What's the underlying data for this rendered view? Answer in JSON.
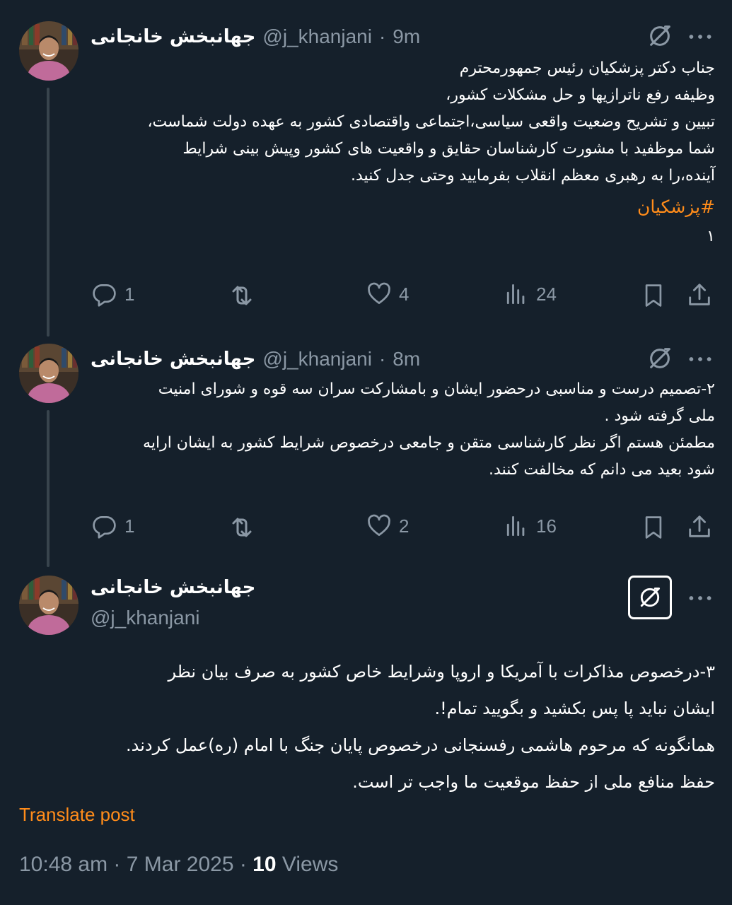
{
  "colors": {
    "background": "#15202b",
    "text": "#ffffff",
    "secondary": "#8b98a5",
    "accent": "#ff8c1a"
  },
  "tweets": [
    {
      "author_name": "جهانبخش خانجانی",
      "handle": "@j_khanjani",
      "time": "9m",
      "lines": [
        "جناب دکتر پزشکیان رئیس جمهورمحترم",
        "وظیفه رفع ناترازیها و حل مشکلات کشور،",
        "تبیین و تشریح وضعیت واقعی سیاسی،اجتماعی واقتصادی کشور به عهده دولت شماست،",
        "شما موظفید با مشورت کارشناسان حقایق و واقعیت های کشور وپیش بینی شرایط",
        "آینده،را به رهبری معظم انقلاب بفرمایید وحتی جدل کنید."
      ],
      "hashtag": "#پزشکیان",
      "number": "۱",
      "replies": "1",
      "likes": "4",
      "views": "24"
    },
    {
      "author_name": "جهانبخش خانجانی",
      "handle": "@j_khanjani",
      "time": "8m",
      "lines": [
        "۲-تصمیم درست و مناسبی درحضور ایشان و بامشارکت سران سه قوه و شورای امنیت",
        "ملی گرفته شود .",
        "مطمئن هستم اگر نظر کارشناسی متقن و جامعی درخصوص شرایط کشور به ایشان ارایه",
        "شود بعید می دانم که مخالفت کنند."
      ],
      "replies": "1",
      "likes": "2",
      "views": "16"
    }
  ],
  "main_tweet": {
    "author_name": "جهانبخش خانجانی",
    "handle": "@j_khanjani",
    "lines": [
      "۳-درخصوص مذاکرات با آمریکا و اروپا وشرایط خاص کشور به صرف بیان نظر",
      "ایشان نباید پا پس بکشید و بگویید تمام!.",
      "همانگونه که مرحوم هاشمی رفسنجانی درخصوص پایان جنگ با امام (ره)عمل کردند.",
      "حفظ منافع ملی از حفظ موقعیت ما واجب تر است."
    ],
    "translate_label": "Translate post",
    "timestamp": "10:48 am · 7 Mar 2025 · ",
    "views_count": "10",
    "views_label": " Views"
  },
  "icons": {
    "more": "more-icon",
    "grok": "grok-icon",
    "reply": "reply-icon",
    "retweet": "retweet-icon",
    "like": "like-icon",
    "views": "views-icon",
    "bookmark": "bookmark-icon",
    "share": "share-icon"
  }
}
